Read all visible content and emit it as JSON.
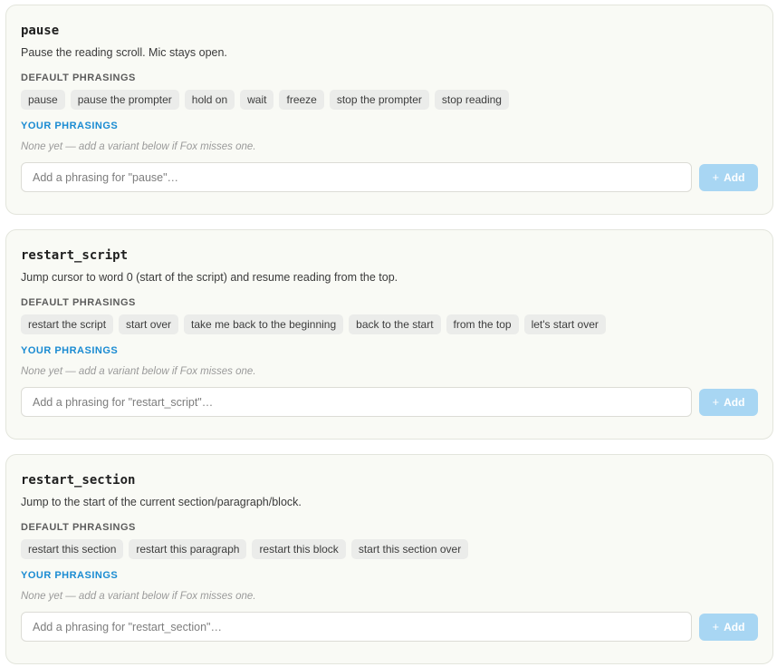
{
  "labels": {
    "default_phrasings": "DEFAULT PHRASINGS",
    "your_phrasings": "YOUR PHRASINGS",
    "empty_note": "None yet — add a variant below if Fox misses one.",
    "add_button": "Add",
    "plus_glyph": "+"
  },
  "colors": {
    "accent": "#1a8bd2",
    "add_button_bg": "#a8d6f3",
    "card_bg": "#f9faf5",
    "chip_bg": "#ebecea"
  },
  "commands": [
    {
      "name": "pause",
      "description": "Pause the reading scroll. Mic stays open.",
      "default_phrasings": [
        "pause",
        "pause the prompter",
        "hold on",
        "wait",
        "freeze",
        "stop the prompter",
        "stop reading"
      ],
      "your_phrasings": [],
      "input_placeholder": "Add a phrasing for \"pause\"…",
      "input_value": ""
    },
    {
      "name": "restart_script",
      "description": "Jump cursor to word 0 (start of the script) and resume reading from the top.",
      "default_phrasings": [
        "restart the script",
        "start over",
        "take me back to the beginning",
        "back to the start",
        "from the top",
        "let's start over"
      ],
      "your_phrasings": [],
      "input_placeholder": "Add a phrasing for \"restart_script\"…",
      "input_value": ""
    },
    {
      "name": "restart_section",
      "description": "Jump to the start of the current section/paragraph/block.",
      "default_phrasings": [
        "restart this section",
        "restart this paragraph",
        "restart this block",
        "start this section over"
      ],
      "your_phrasings": [],
      "input_placeholder": "Add a phrasing for \"restart_section\"…",
      "input_value": ""
    }
  ]
}
